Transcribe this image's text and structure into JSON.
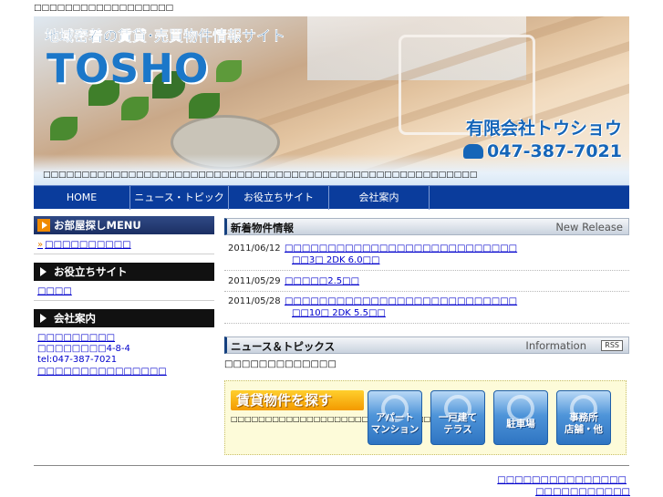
{
  "header": {
    "top_text": "□□□□□□□□□□□□□□□□□□",
    "tagline": "地域密着の賃貸･売買物件情報サイト",
    "logo": "TOSHO",
    "company": "有限会社トウショウ",
    "phone": "047-387-7021",
    "description": "□□□□□□□□□□□□□□□□□□□□□□□□□□□□□□□□□□□□□□□□□□□□□□□□□□□□□□□□"
  },
  "nav": {
    "items": [
      {
        "label": "HOME"
      },
      {
        "label": "ニュース・トピックス"
      },
      {
        "label": "お役立ちサイト"
      },
      {
        "label": "会社案内"
      },
      {
        "label": ""
      }
    ]
  },
  "sidebar": {
    "search_menu": {
      "title": "お部屋探しMENU",
      "link": "□□□□□□□□□□"
    },
    "useful": {
      "title": "お役立ちサイト",
      "link": "□□□□"
    },
    "company": {
      "title": "会社案内",
      "name": "□□□□□□□□□",
      "address": "□□□□□□□□4-8-4",
      "tel": "tel:047-387-7021",
      "map_link": "□□□□□□□□□□□□□□□"
    }
  },
  "new_release": {
    "title": "新着物件情報",
    "en_title": "New Release",
    "items": [
      {
        "date": "2011/06/12",
        "title": "□□□□□□□□□□□□□□□□□□□□□□□□□□□",
        "sub": "□□3□ 2DK 6.0□□"
      },
      {
        "date": "2011/05/29",
        "title": "□□□□□2.5□□",
        "sub": ""
      },
      {
        "date": "2011/05/28",
        "title": "□□□□□□□□□□□□□□□□□□□□□□□□□□□",
        "sub": "□□10□ 2DK 5.5□□"
      }
    ]
  },
  "topics": {
    "title": "ニュース＆トピックス",
    "en_title": "Information",
    "rss": "RSS",
    "text": "□□□□□□□□□□□□□"
  },
  "property_search": {
    "title": "賃貸物件を探す",
    "description": "□□□□□□□□□□□□□□□□□□□□□□□□□□□□□□□□□□□□",
    "buttons": [
      {
        "line1": "アパート",
        "line2": "マンション"
      },
      {
        "line1": "一戸建て",
        "line2": "テラス"
      },
      {
        "line1": "駐車場",
        "line2": ""
      },
      {
        "line1": "事務所",
        "line2": "店舗・他"
      }
    ]
  },
  "footer": {
    "link1": "□□□□□□□□□□□□□□□",
    "link2": "□□□□□□□□□□□"
  }
}
